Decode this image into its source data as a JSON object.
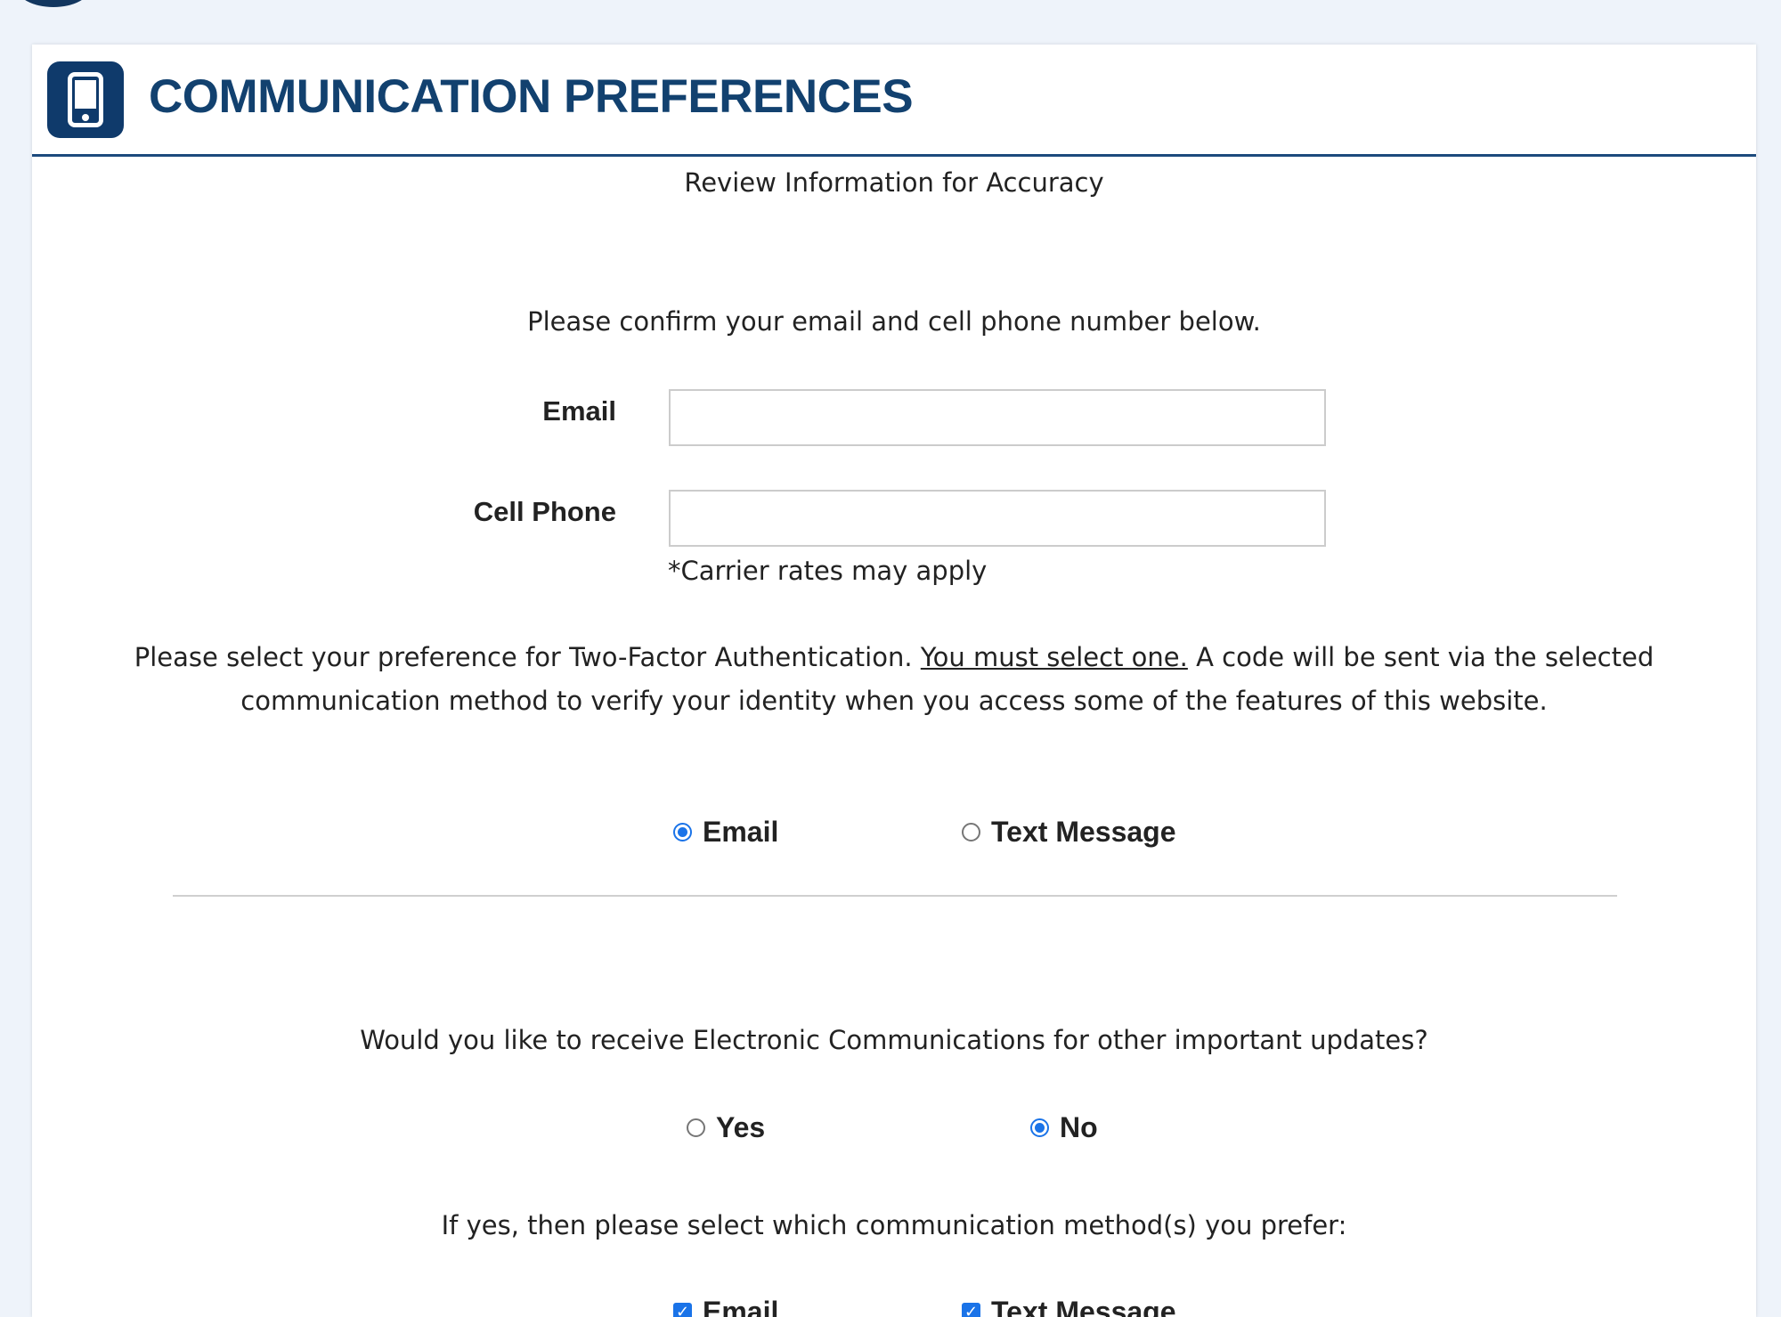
{
  "header": {
    "title": "COMMUNICATION PREFERENCES"
  },
  "subtitle": "Review Information for Accuracy",
  "confirm": {
    "intro": "Please confirm your email and cell phone number below.",
    "email_label": "Email",
    "email_value": "",
    "phone_label": "Cell Phone",
    "phone_value": "",
    "carrier_note": "*Carrier rates may apply"
  },
  "two_factor": {
    "text_before": "Please select your preference for Two-Factor Authentication. ",
    "underlined": "You must select one.",
    "text_after": " A code will be sent via the selected communication method to verify your identity when you access some of the features of this website.",
    "options": [
      {
        "label": "Email",
        "checked": true
      },
      {
        "label": "Text Message",
        "checked": false
      }
    ]
  },
  "electronic_comms": {
    "question": "Would you like to receive Electronic Communications for other important updates?",
    "options": [
      {
        "label": "Yes",
        "checked": false
      },
      {
        "label": "No",
        "checked": true
      }
    ]
  },
  "methods": {
    "prompt": "If yes, then please select which communication method(s) you prefer:",
    "options": [
      {
        "label": "Email",
        "checked": true
      },
      {
        "label": "Text Message",
        "checked": true
      }
    ]
  },
  "colors": {
    "brand_navy": "#12416f",
    "accent_blue": "#1a73e8",
    "page_background": "#eef3fa"
  },
  "icons": {
    "header": "mobile-phone-icon"
  }
}
